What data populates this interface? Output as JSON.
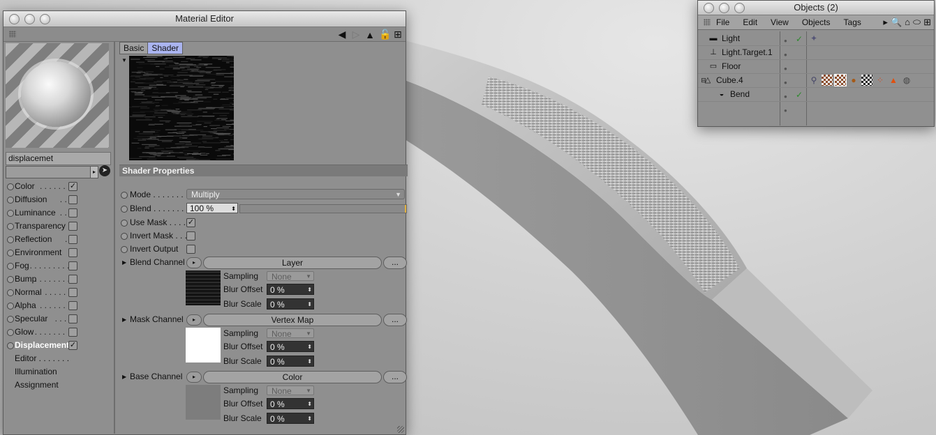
{
  "material_editor": {
    "title": "Material Editor",
    "material_name": "displacemet",
    "tabs": [
      "Basic",
      "Shader"
    ],
    "active_tab": "Shader",
    "channels": [
      {
        "label": "Color",
        "dots": ". . . . . . .",
        "checked": true
      },
      {
        "label": "Diffusion",
        "dots": ". . . .",
        "checked": false
      },
      {
        "label": "Luminance",
        "dots": ". .",
        "checked": false
      },
      {
        "label": "Transparency",
        "dots": "",
        "checked": false
      },
      {
        "label": "Reflection",
        "dots": ". . .",
        "checked": false
      },
      {
        "label": "Environment",
        "dots": "",
        "checked": false
      },
      {
        "label": "Fog",
        "dots": ". . . . . . . . .",
        "checked": false
      },
      {
        "label": "Bump",
        "dots": ". . . . . . . .",
        "checked": false
      },
      {
        "label": "Normal",
        "dots": ". . . . . .",
        "checked": false
      },
      {
        "label": "Alpha",
        "dots": ". . . . . . .",
        "checked": false
      },
      {
        "label": "Specular",
        "dots": ". . . .",
        "checked": false
      },
      {
        "label": "Glow",
        "dots": ". . . . . . .",
        "checked": false
      },
      {
        "label": "Displacement",
        "dots": "",
        "checked": true
      }
    ],
    "extra_items": [
      "Editor . . . . . . .",
      "Illumination",
      "Assignment"
    ],
    "shader_properties": {
      "heading": "Shader Properties",
      "mode_label": "Mode . . . . . . . . .",
      "mode_value": "Multiply",
      "blend_label": "Blend . . . . . . . .",
      "blend_value": "100 %",
      "use_mask_label": "Use Mask . . . . .",
      "use_mask_checked": true,
      "invert_mask_label": "Invert Mask . . .",
      "invert_output_label": "Invert Output",
      "blend_channel": {
        "label": "Blend Channel",
        "button": "Layer",
        "more": "..."
      },
      "mask_channel": {
        "label": "Mask Channel",
        "button": "Vertex Map",
        "more": "..."
      },
      "base_channel": {
        "label": "Base Channel",
        "button": "Color",
        "more": "..."
      },
      "sub_fields": {
        "sampling_label": "Sampling",
        "sampling_value": "None",
        "blur_offset_label": "Blur Offset",
        "blur_offset_value": "0 %",
        "blur_scale_label": "Blur Scale",
        "blur_scale_value": "0 %"
      }
    }
  },
  "objects_window": {
    "title": "Objects (2)",
    "menus": [
      "File",
      "Edit",
      "View",
      "Objects",
      "Tags"
    ],
    "objects": [
      {
        "name": "Light",
        "icon": "light-icon",
        "checked": true
      },
      {
        "name": "Light.Target.1",
        "icon": "target-icon",
        "checked": false
      },
      {
        "name": "Floor",
        "icon": "floor-icon",
        "checked": false
      },
      {
        "name": "Cube.4",
        "icon": "cube-icon",
        "checked": false
      },
      {
        "name": "Bend",
        "icon": "bend-deformer-icon",
        "checked": true
      }
    ]
  }
}
